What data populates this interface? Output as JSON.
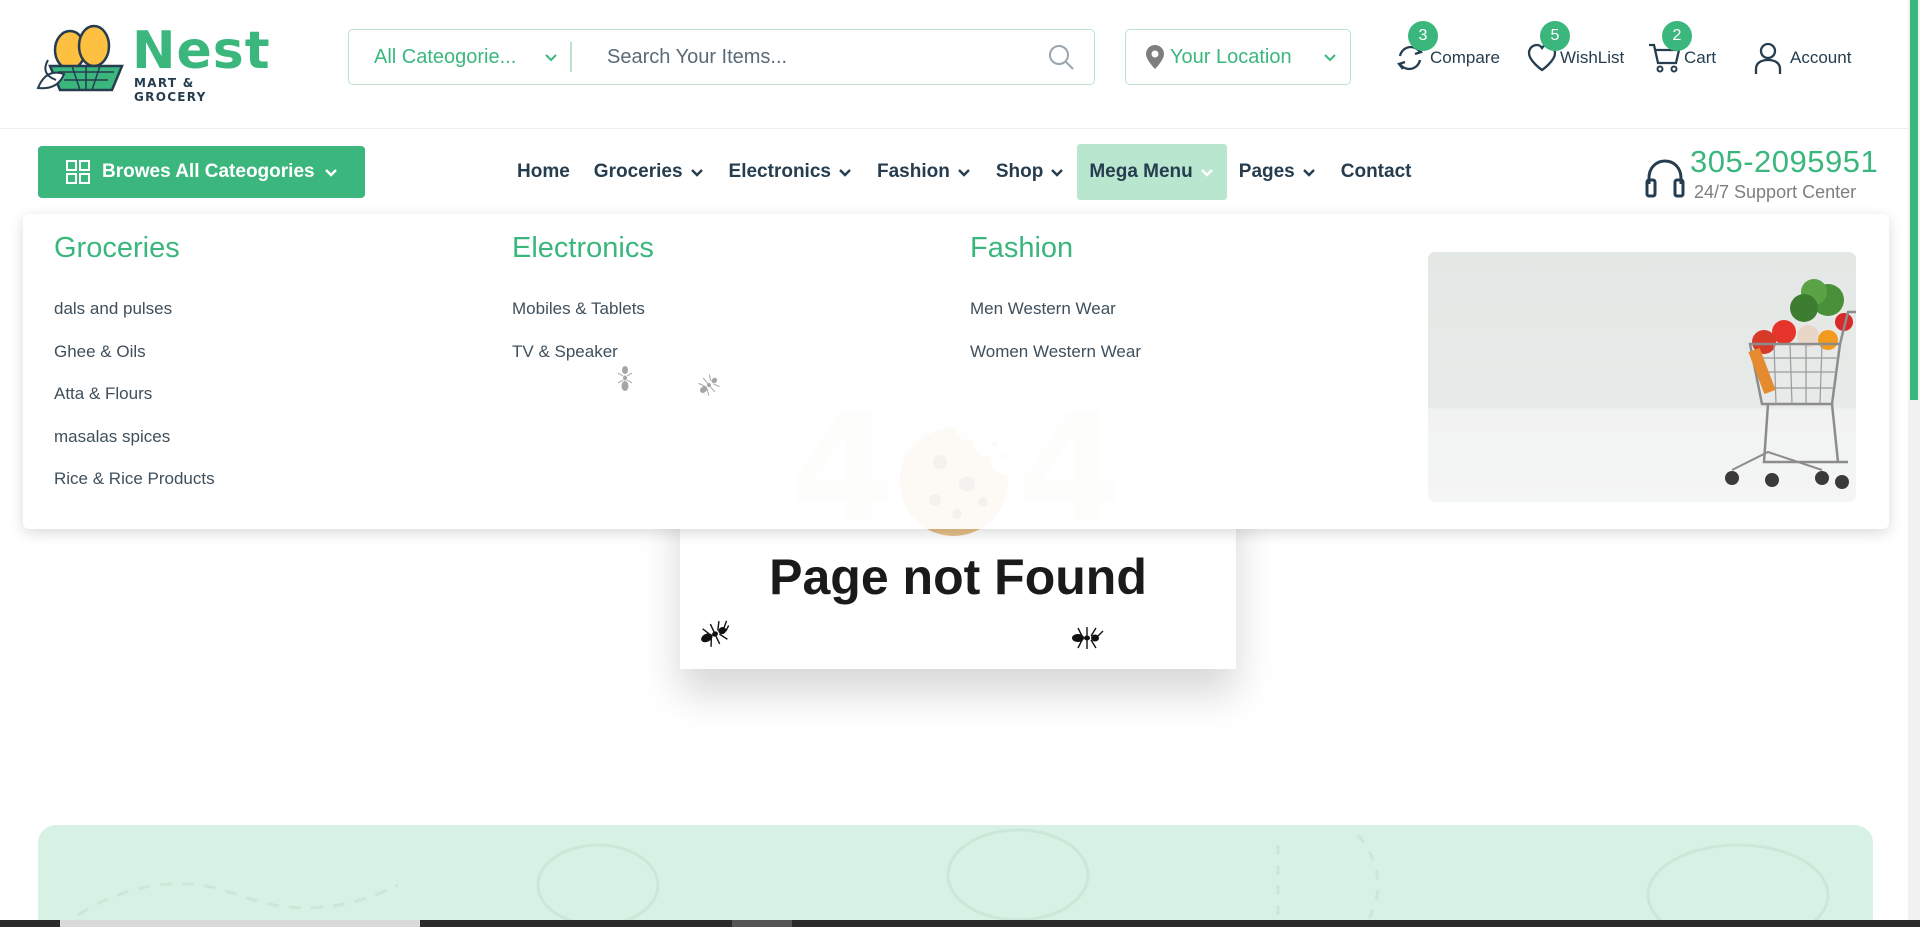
{
  "brand": {
    "name": "Nest",
    "tagline": "MART & GROCERY"
  },
  "search": {
    "category_label": "All Cateogorie...",
    "placeholder": "Search Your Items..."
  },
  "location": {
    "label": "Your Location"
  },
  "header_actions": {
    "compare": {
      "label": "Compare",
      "count": "3"
    },
    "wishlist": {
      "label": "WishList",
      "count": "5"
    },
    "cart": {
      "label": "Cart",
      "count": "2"
    },
    "account": {
      "label": "Account"
    }
  },
  "nav": {
    "browse_label": "Browes All Cateogories",
    "items": [
      {
        "label": "Home",
        "dropdown": false
      },
      {
        "label": "Groceries",
        "dropdown": true
      },
      {
        "label": "Electronics",
        "dropdown": true
      },
      {
        "label": "Fashion",
        "dropdown": true
      },
      {
        "label": "Shop",
        "dropdown": true
      },
      {
        "label": "Mega Menu",
        "dropdown": true,
        "active": true
      },
      {
        "label": "Pages",
        "dropdown": true
      },
      {
        "label": "Contact",
        "dropdown": false
      }
    ]
  },
  "support": {
    "phone": "305-2095951",
    "subtitle": "24/7 Support Center"
  },
  "mega_menu": {
    "columns": [
      {
        "title": "Groceries",
        "items": [
          "dals and pulses",
          "Ghee & Oils",
          "Atta & Flours",
          "masalas spices",
          "Rice & Rice Products"
        ]
      },
      {
        "title": "Electronics",
        "items": [
          "Mobiles & Tablets",
          "TV & Speaker"
        ]
      },
      {
        "title": "Fashion",
        "items": [
          "Men Western Wear",
          "Women Western Wear"
        ]
      }
    ]
  },
  "error_page": {
    "digit_1": "4",
    "digit_2": "0",
    "digit_3": "4",
    "title": "Page not Found"
  },
  "colors": {
    "brand": "#3bb77e",
    "brand_light": "#bce3c9",
    "text_dark": "#253d4e",
    "active_nav_bg": "#b9e6cf",
    "newsletter_bg": "#d8f1e5"
  }
}
